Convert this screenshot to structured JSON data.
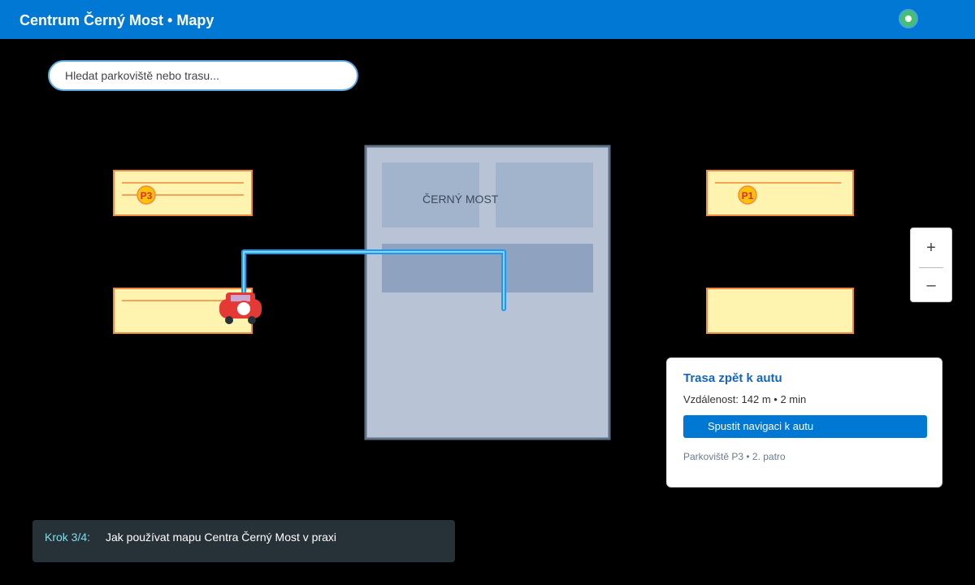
{
  "header": {
    "title": "Centrum Černý Most • Mapy",
    "status_icon": "status-indicator-icon"
  },
  "search": {
    "placeholder": "Hledat parkoviště nebo trasu..."
  },
  "map": {
    "building_label": "ČERNÝ MOST",
    "parking_markers": [
      "P3",
      "P1"
    ],
    "car_icon": "car-icon",
    "colors": {
      "route": "#1a9bf0",
      "parking_fill": "#fff3b0",
      "parking_border": "#f08a3e",
      "building": "#b8c4d6",
      "car": "#e53935"
    }
  },
  "zoom": {
    "in_label": "+",
    "out_label": "–"
  },
  "route_panel": {
    "title": "Trasa zpět k autu",
    "distance": "Vzdálenost: 142 m • 2 min",
    "button_label": "Spustit navigaci k autu",
    "location": "Parkoviště P3 • 2. patro"
  },
  "tutorial": {
    "step": "Krok 3/4:",
    "text": "Jak používat mapu Centra Černý Most v praxi"
  }
}
